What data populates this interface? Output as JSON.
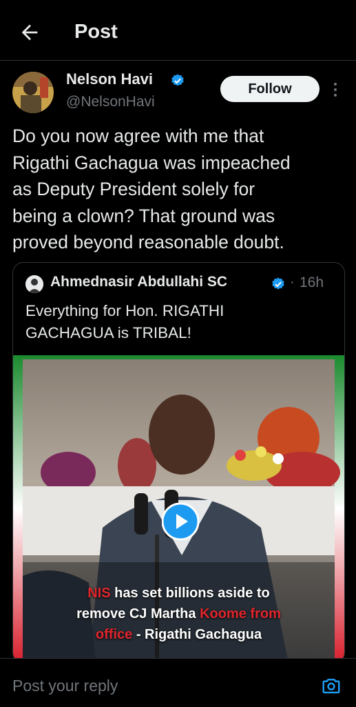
{
  "header": {
    "title": "Post",
    "back_icon": "arrow-left-icon"
  },
  "post": {
    "author_name": "Nelson Havi",
    "author_handle": "@NelsonHavi",
    "verified": true,
    "follow_label": "Follow",
    "text": "Do you now agree with me that\nRigathi Gachagua was impeached\nas Deputy President solely for\nbeing a clown? That ground was\nproved beyond reasonable doubt."
  },
  "quote": {
    "author_name": "Ahmednasir Abdullahi SC",
    "verified": true,
    "separator": "·",
    "time": "16h",
    "text": "Everything for Hon. RIGATHI\nGACHAGUA is TRIBAL!",
    "media": {
      "type": "video",
      "caption_line1_red": "NIS",
      "caption_line1": " has set billions aside to",
      "caption_line2_white": "remove CJ Martha ",
      "caption_line2_red": "Koome from",
      "caption_line3_red": "office",
      "caption_line3": " - Rigathi Gachagua"
    }
  },
  "reply": {
    "placeholder": "Post your reply",
    "camera_icon": "camera-icon"
  },
  "colors": {
    "background": "#000000",
    "text": "#e7e9ea",
    "secondary": "#71767b",
    "verified": "#1d9bf0",
    "border": "#2f3336",
    "caption_red": "#e0252b"
  }
}
